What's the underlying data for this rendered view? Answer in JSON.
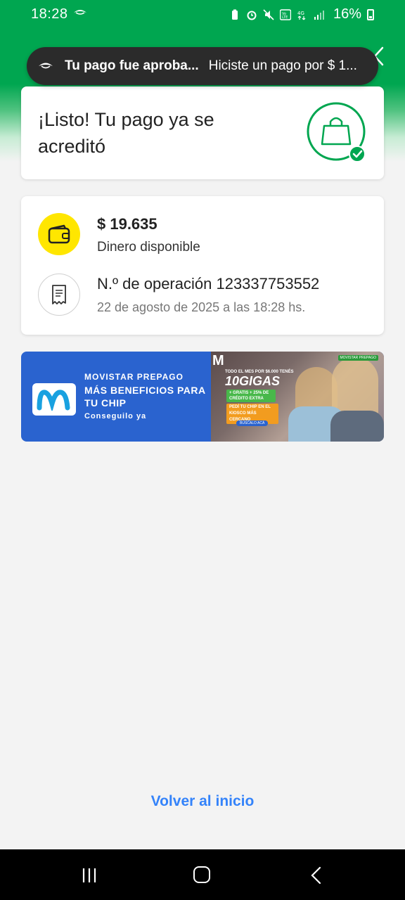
{
  "status_bar": {
    "time": "18:28",
    "battery": "16%",
    "icons": [
      "battery-saver-icon",
      "alarm-icon",
      "mute-icon",
      "volte-icon",
      "4g-icon",
      "signal-icon"
    ]
  },
  "notification": {
    "title": "Tu pago fue aproba...",
    "body": "Hiciste un pago por $ 1..."
  },
  "success": {
    "title": "¡Listo! Tu pago ya se acreditó"
  },
  "details": {
    "amount": "$ 19.635",
    "amount_label": "Dinero disponible",
    "operation": "N.º de operación 123337753552",
    "date": "22 de agosto de 2025 a las 18:28 hs."
  },
  "banner": {
    "kicker": "MOVISTAR PREPAGO",
    "headline": "MÁS BENEFICIOS PARA TU CHIP",
    "cta": "Conseguilo ya",
    "promo": {
      "tag": "MOVISTAR PREPAGO",
      "small": "TODO EL MES POR $6.000 TENÉS",
      "big": "10GIGAS",
      "green": "+ GRATIS + 25% DE CRÉDITO EXTRA",
      "orange": "PEDÍ TU CHIP EN EL KIOSCO MÁS CERCANO",
      "pill": "BUSCALO ACÁ"
    }
  },
  "footer": {
    "back_home": "Volver al inicio"
  },
  "colors": {
    "brand_green": "#00a650",
    "link_blue": "#3483fa",
    "wallet_yellow": "#ffe600",
    "banner_blue": "#2a63cf"
  }
}
